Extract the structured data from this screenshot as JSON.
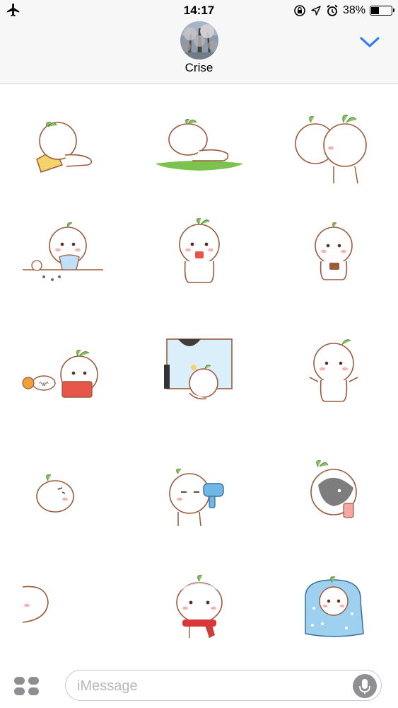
{
  "status_bar": {
    "time": "14:17",
    "battery_percent": "38%",
    "battery_level": 0.38,
    "icons": [
      "airplane-icon",
      "rotation-lock-icon",
      "location-icon",
      "alarm-icon",
      "battery-icon"
    ]
  },
  "header": {
    "contact_name": "Crise",
    "collapse_icon": "chevron-down-icon",
    "accent_color": "#2f7cf6"
  },
  "stickers": [
    {
      "name": "sticker-lying-on-pillow",
      "text": ""
    },
    {
      "name": "sticker-lying-on-grass",
      "text": ""
    },
    {
      "name": "sticker-two-hugging",
      "text": ""
    },
    {
      "name": "sticker-eating-at-table",
      "text": ""
    },
    {
      "name": "sticker-holding-food",
      "text": ""
    },
    {
      "name": "sticker-looking-at-phone",
      "text": ""
    },
    {
      "name": "sticker-playing-drum",
      "text": "^w^"
    },
    {
      "name": "sticker-at-window",
      "text": ""
    },
    {
      "name": "sticker-open-arms",
      "text": ""
    },
    {
      "name": "sticker-round-face",
      "text": ""
    },
    {
      "name": "sticker-hair-dryer",
      "text": ""
    },
    {
      "name": "sticker-with-hood-phone",
      "text": ""
    },
    {
      "name": "sticker-peeking",
      "text": ""
    },
    {
      "name": "sticker-red-scarf",
      "text": ""
    },
    {
      "name": "sticker-blue-blanket",
      "text": ""
    }
  ],
  "composer": {
    "placeholder": "iMessage",
    "apps_icon": "app-drawer-icon",
    "mic_icon": "microphone-icon"
  }
}
